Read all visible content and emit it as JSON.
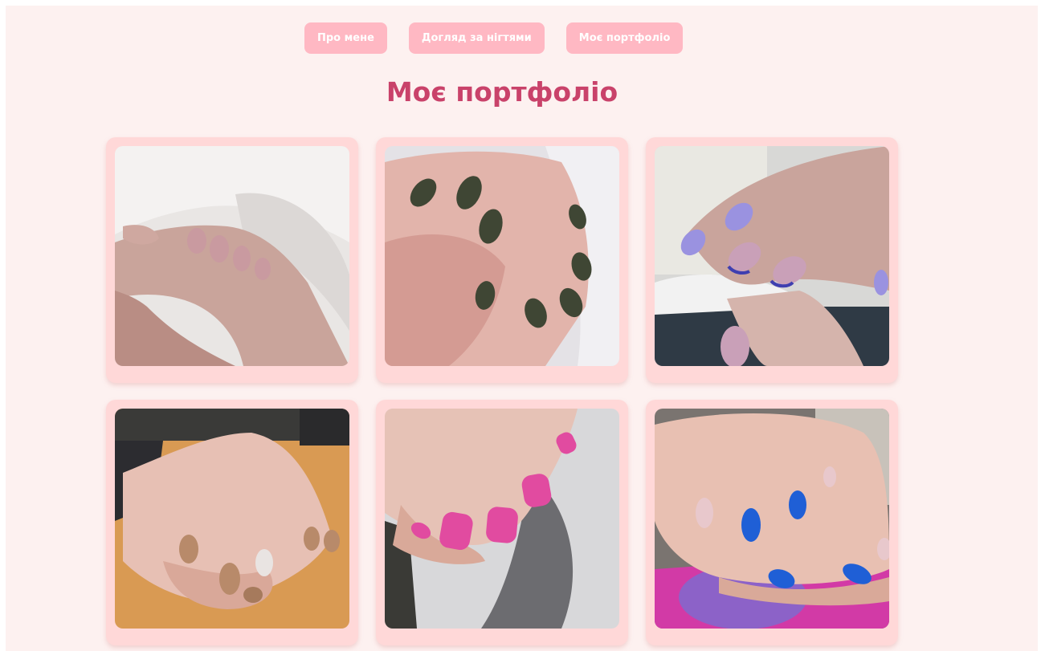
{
  "nav": {
    "items": [
      {
        "label": "Про мене"
      },
      {
        "label": "Догляд за нігтями"
      },
      {
        "label": "Моє портфоліо"
      }
    ]
  },
  "portfolio": {
    "title": "Моє портфоліо",
    "photos": [
      {
        "name": "nude-pink-nails-photo",
        "nail_color": "#c99aa0"
      },
      {
        "name": "dark-olive-nails-photo",
        "nail_color": "#3f4634"
      },
      {
        "name": "lavender-french-nails-photo",
        "nail_color": "#9a92e0"
      },
      {
        "name": "glitter-bronze-nails-photo",
        "nail_color": "#b88a6a"
      },
      {
        "name": "hot-pink-nails-photo",
        "nail_color": "#e14ba0"
      },
      {
        "name": "blue-nude-nails-photo",
        "nail_color": "#1f5fd6"
      }
    ]
  },
  "colors": {
    "page_bg": "#fdf1f0",
    "nav_button_bg": "#ffb8c3",
    "title_color": "#c9426a",
    "card_bg": "#ffd8d8"
  }
}
